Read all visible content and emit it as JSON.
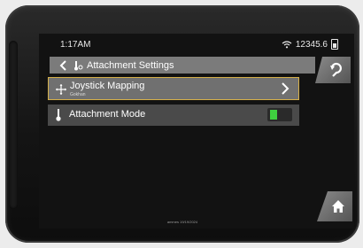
{
  "status": {
    "time": "1:17AM",
    "hours": "12345.6",
    "wifi_icon": "wifi-icon",
    "battery_icon": "battery-icon"
  },
  "header": {
    "title": "Attachment Settings",
    "back_icon": "chevron-left-icon",
    "attachment_icon": "attachment-icon",
    "undo_icon": "undo-back-icon"
  },
  "rows": [
    {
      "label": "Joystick Mapping",
      "sub": "Gokhan",
      "icon": "move-arrows-icon",
      "trailing": "chevron-right-icon",
      "selected": true
    },
    {
      "label": "Attachment Mode",
      "icon": "thermometer-icon",
      "toggle_on": true
    }
  ],
  "footer": {
    "text": "ammes 19/19/2024"
  },
  "colors": {
    "accent_border": "#d6b14a",
    "toggle_on": "#3fcf3f",
    "header_bg": "#7b7b7b"
  }
}
